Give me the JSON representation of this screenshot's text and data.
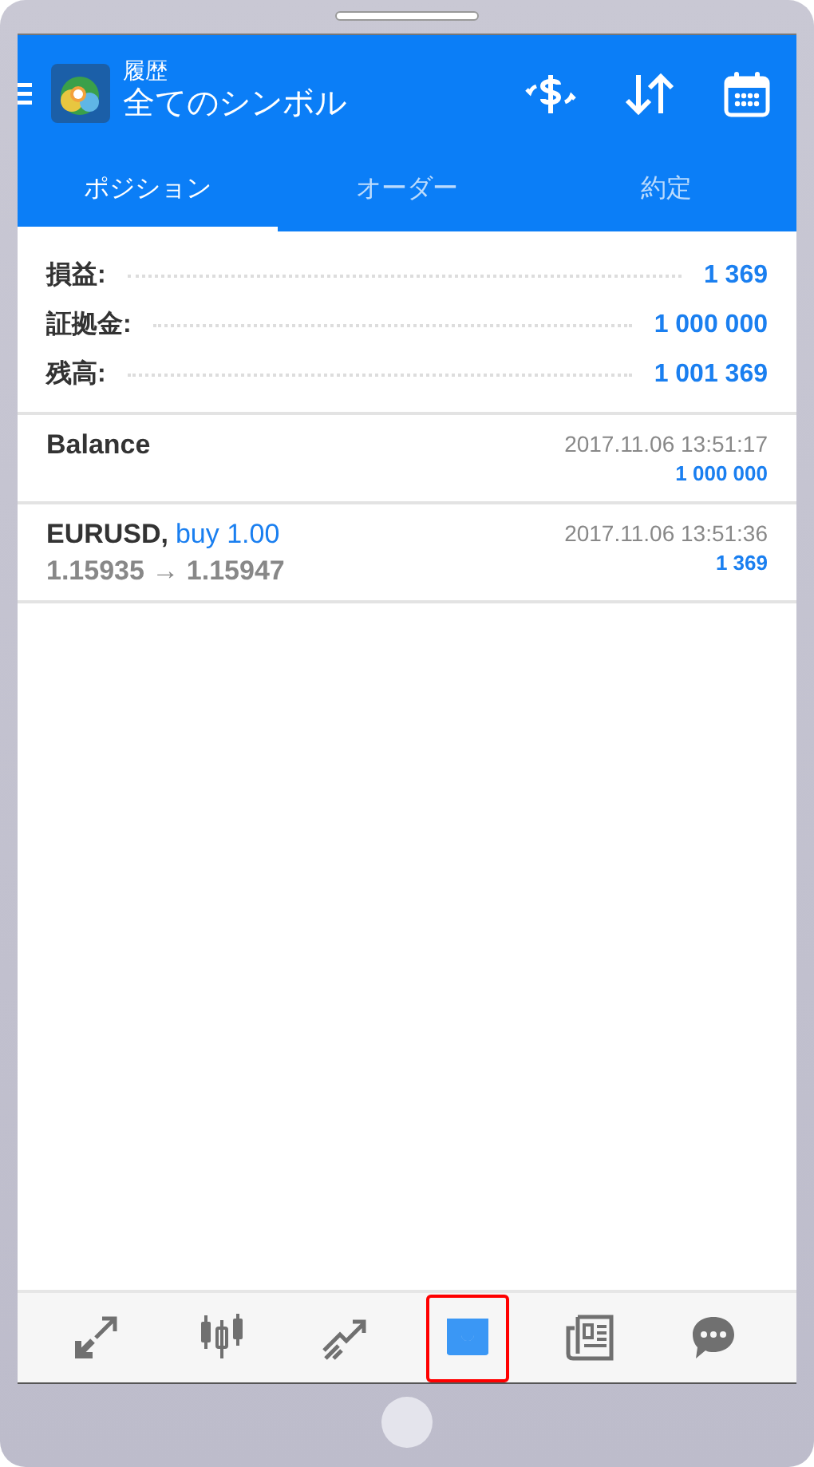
{
  "header": {
    "subtitle": "履歴",
    "title": "全てのシンボル"
  },
  "tabs": [
    {
      "label": "ポジション",
      "selected": true
    },
    {
      "label": "オーダー",
      "selected": false
    },
    {
      "label": "約定",
      "selected": false
    }
  ],
  "summary": [
    {
      "label": "損益:",
      "value": "1 369"
    },
    {
      "label": "証拠金:",
      "value": "1 000 000"
    },
    {
      "label": "残高:",
      "value": "1 001 369"
    }
  ],
  "deals": [
    {
      "kind": "balance",
      "title": "Balance",
      "time": "2017.11.06 13:51:17",
      "profit": "1 000 000"
    },
    {
      "kind": "trade",
      "symbol": "EURUSD,",
      "action": "buy 1.00",
      "prices": "1.15935 → 1.15947",
      "time": "2017.11.06 13:51:36",
      "profit": "1 369"
    }
  ],
  "bottom_nav": [
    {
      "kind": "trade",
      "selected": false,
      "highlighted": false
    },
    {
      "kind": "chart",
      "selected": false,
      "highlighted": false
    },
    {
      "kind": "quotes",
      "selected": false,
      "highlighted": false
    },
    {
      "kind": "history",
      "selected": true,
      "highlighted": true
    },
    {
      "kind": "news",
      "selected": false,
      "highlighted": false
    },
    {
      "kind": "chat",
      "selected": false,
      "highlighted": false
    }
  ]
}
